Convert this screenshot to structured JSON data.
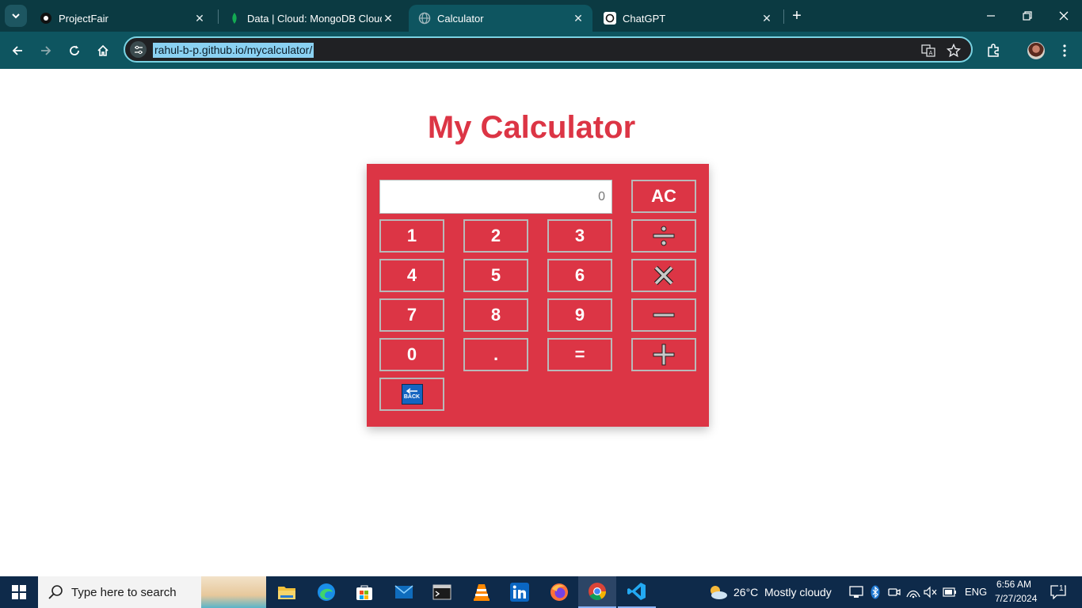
{
  "browser": {
    "tabs": [
      {
        "title": "ProjectFair",
        "active": false
      },
      {
        "title": "Data | Cloud: MongoDB Cloud",
        "active": false
      },
      {
        "title": "Calculator",
        "active": true
      },
      {
        "title": "ChatGPT",
        "active": false
      }
    ],
    "url": "rahul-b-p.github.io/mycalculator/",
    "accent_color": "#0e5560"
  },
  "page": {
    "title": "My Calculator",
    "display_value": "0",
    "accent_color": "#dc3545"
  },
  "calculator": {
    "clear_label": "AC",
    "digits": [
      "1",
      "2",
      "3",
      "4",
      "5",
      "6",
      "7",
      "8",
      "9",
      "0"
    ],
    "dot_label": ".",
    "equals_label": "=",
    "divide_symbol": "÷",
    "multiply_symbol": "×",
    "subtract_symbol": "−",
    "add_symbol": "+",
    "back_label": "BACK"
  },
  "taskbar": {
    "search_placeholder": "Type here to search",
    "weather_temp": "26°C",
    "weather_desc": "Mostly cloudy",
    "language": "ENG",
    "time": "6:56 AM",
    "date": "7/27/2024",
    "notification_count": "1"
  }
}
